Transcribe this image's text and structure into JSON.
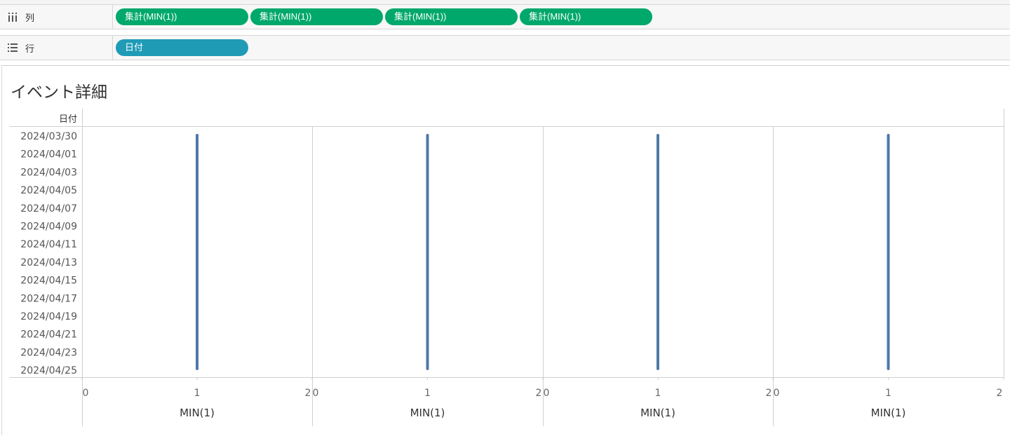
{
  "columns_shelf": {
    "label": "列",
    "icon": "columns-icon",
    "pills": [
      "集計(MIN(1))",
      "集計(MIN(1))",
      "集計(MIN(1))",
      "集計(MIN(1))"
    ]
  },
  "rows_shelf": {
    "label": "行",
    "icon": "rows-icon",
    "pills": [
      "日付"
    ]
  },
  "colors": {
    "measure_pill": "#00a86b",
    "dimension_pill": "#1f9bb6",
    "mark": "#4e79a7"
  },
  "view": {
    "title": "イベント詳細"
  },
  "chart_data": {
    "type": "gantt",
    "row_header": "日付",
    "date_tick_labels": [
      "2024/03/30",
      "2024/04/01",
      "2024/04/03",
      "2024/04/05",
      "2024/04/07",
      "2024/04/09",
      "2024/04/11",
      "2024/04/13",
      "2024/04/15",
      "2024/04/17",
      "2024/04/19",
      "2024/04/21",
      "2024/04/23",
      "2024/04/25"
    ],
    "date_range": [
      "2024/03/29",
      "2024/04/25"
    ],
    "panes": [
      {
        "axis_label": "MIN(1)",
        "xlim": [
          0,
          2
        ],
        "ticks": [
          0,
          1,
          2
        ],
        "value": 1
      },
      {
        "axis_label": "MIN(1)",
        "xlim": [
          0,
          2
        ],
        "ticks": [
          0,
          1,
          2
        ],
        "value": 1
      },
      {
        "axis_label": "MIN(1)",
        "xlim": [
          0,
          2
        ],
        "ticks": [
          0,
          1,
          2
        ],
        "value": 1
      },
      {
        "axis_label": "MIN(1)",
        "xlim": [
          0,
          2
        ],
        "ticks": [
          0,
          1,
          2
        ],
        "value": 1
      }
    ]
  }
}
